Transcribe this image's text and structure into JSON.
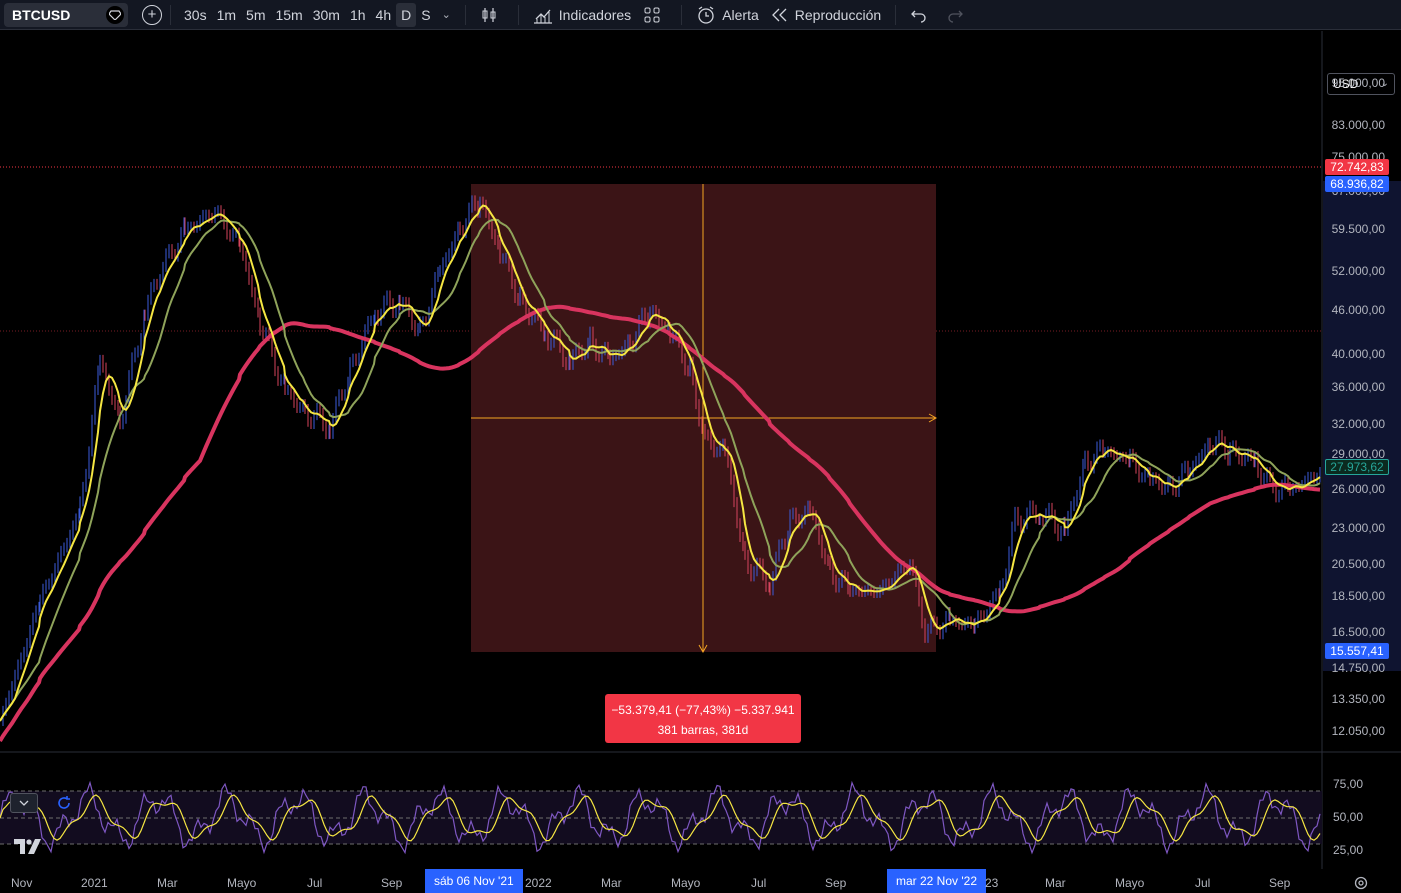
{
  "toolbar": {
    "symbol": "BTCUSD",
    "add_symbol_icon": "plus-circle-icon",
    "intervals": [
      "30s",
      "1m",
      "5m",
      "15m",
      "30m",
      "1h",
      "4h",
      "D",
      "S"
    ],
    "active_interval": "D",
    "indicators_label": "Indicadores",
    "alert_label": "Alerta",
    "replay_label": "Reproducción",
    "undo_icon": "undo-icon",
    "redo_icon": "redo-icon"
  },
  "currency": "USD",
  "price_axis": [
    "95.000,00",
    "83.000,00",
    "75.000,00",
    "67.000,00",
    "59.500,00",
    "52.000,00",
    "46.000,00",
    "40.000,00",
    "36.000,00",
    "32.000,00",
    "29.000,00",
    "26.000,00",
    "23.000,00",
    "20.500,00",
    "18.500,00",
    "16.500,00",
    "14.750,00",
    "13.350,00",
    "12.050,00"
  ],
  "price_badges": {
    "high_line": "72.742,83",
    "measure_top": "68.936,82",
    "last_price": "27.973,62",
    "measure_bottom": "15.557,41"
  },
  "measure": {
    "line1": "−53.379,41 (−77,43%) −5.337.941",
    "line2": "381 barras, 381d"
  },
  "rsi_axis": [
    "75,00",
    "50,00",
    "25,00"
  ],
  "time_axis": {
    "labels": [
      "Nov",
      "2021",
      "Mar",
      "Mayo",
      "Jul",
      "Sep",
      "2022",
      "Mar",
      "Mayo",
      "Jul",
      "Sep",
      "23",
      "Mar",
      "Mayo",
      "Jul",
      "Sep"
    ],
    "start_badge": "sáb 06 Nov '21",
    "end_badge": "mar 22 Nov '22"
  },
  "colors": {
    "background": "#000000",
    "toolbar": "#131722",
    "ma_fast": "#f5e642",
    "ma_mid": "#8fa35a",
    "ma_slow": "#d8345f",
    "measure_fill": "#3b1416",
    "measure_badge": "#f23645",
    "date_badge": "#2962ff",
    "rsi_line": "#7e57c2",
    "rsi_signal": "#f5e642",
    "high_badge": "#f23645",
    "last_badge_border": "#26a69a"
  }
}
